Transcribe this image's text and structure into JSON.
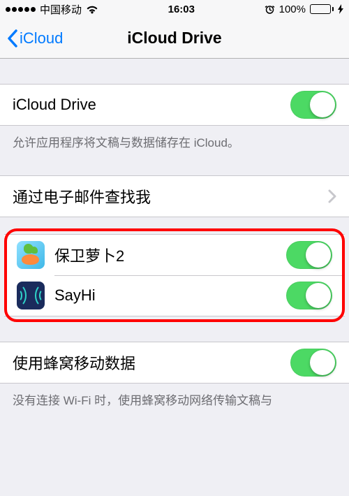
{
  "statusBar": {
    "carrier": "中国移动",
    "time": "16:03",
    "batteryPct": "100%"
  },
  "nav": {
    "back": "iCloud",
    "title": "iCloud Drive"
  },
  "mainToggle": {
    "label": "iCloud Drive",
    "on": true
  },
  "mainFooter": "允许应用程序将文稿与数据储存在 iCloud。",
  "findMe": {
    "label": "通过电子邮件查找我"
  },
  "apps": [
    {
      "label": "保卫萝卜2",
      "icon": "carrot",
      "on": true
    },
    {
      "label": "SayHi",
      "icon": "sayhi",
      "on": true
    }
  ],
  "cellular": {
    "label": "使用蜂窝移动数据",
    "on": true
  },
  "cellularFooter": "没有连接 Wi-Fi 时，使用蜂窝移动网络传输文稿与"
}
